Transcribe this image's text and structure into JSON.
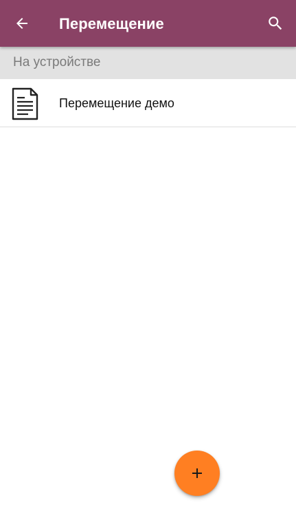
{
  "appbar": {
    "title": "Перемещение",
    "background": "#8a4265",
    "back_icon": "arrow-back-icon",
    "search_icon": "search-icon"
  },
  "section": {
    "label": "На устройстве",
    "background": "#e2e2e2"
  },
  "list": {
    "items": [
      {
        "label": "Перемещение демо",
        "icon": "document-icon"
      }
    ]
  },
  "fab": {
    "icon": "plus-icon",
    "color": "#ff7f22"
  }
}
